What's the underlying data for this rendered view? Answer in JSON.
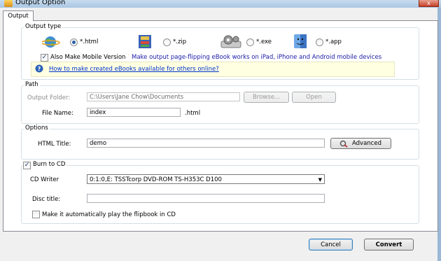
{
  "window": {
    "title": "Output Option",
    "close_label": "x"
  },
  "tab": {
    "label": "Output"
  },
  "output_type": {
    "group_label": "Output type",
    "options": [
      {
        "label": "*.html",
        "selected": true,
        "icon": "globe-icon"
      },
      {
        "label": "*.zip",
        "selected": false,
        "icon": "archive-icon"
      },
      {
        "label": "*.exe",
        "selected": false,
        "icon": "gear-icon"
      },
      {
        "label": "*.app",
        "selected": false,
        "icon": "mac-finder-icon"
      }
    ],
    "mobile_checkbox_label": "Also Make Mobile Version",
    "mobile_checked": true,
    "mobile_description": "Make output page-flipping eBook works on iPad, iPhone and Android mobile devices",
    "info_link": "How to make created eBooks available for others online?"
  },
  "path": {
    "group_label": "Path",
    "output_folder_label": "Output Folder:",
    "output_folder_value": "C:\\Users\\Jane Chow\\Documents",
    "browse_label": "Browse...",
    "open_label": "Open",
    "file_name_label": "File Name:",
    "file_name_value": "index",
    "extension": ".html"
  },
  "options": {
    "group_label": "Options",
    "html_title_label": "HTML Title:",
    "html_title_value": "demo",
    "advanced_label": "Advanced"
  },
  "burn": {
    "checkbox_label": "Burn to CD",
    "checked": true,
    "cd_writer_label": "CD Writer",
    "cd_writer_value": "0:1:0,E: TSSTcorp DVD-ROM TS-H353C D100",
    "disc_title_label": "Disc title:",
    "disc_title_value": "",
    "autoplay_label": "Make it automatically play the flipbook in CD",
    "autoplay_checked": false
  },
  "footer": {
    "cancel_label": "Cancel",
    "convert_label": "Convert"
  }
}
